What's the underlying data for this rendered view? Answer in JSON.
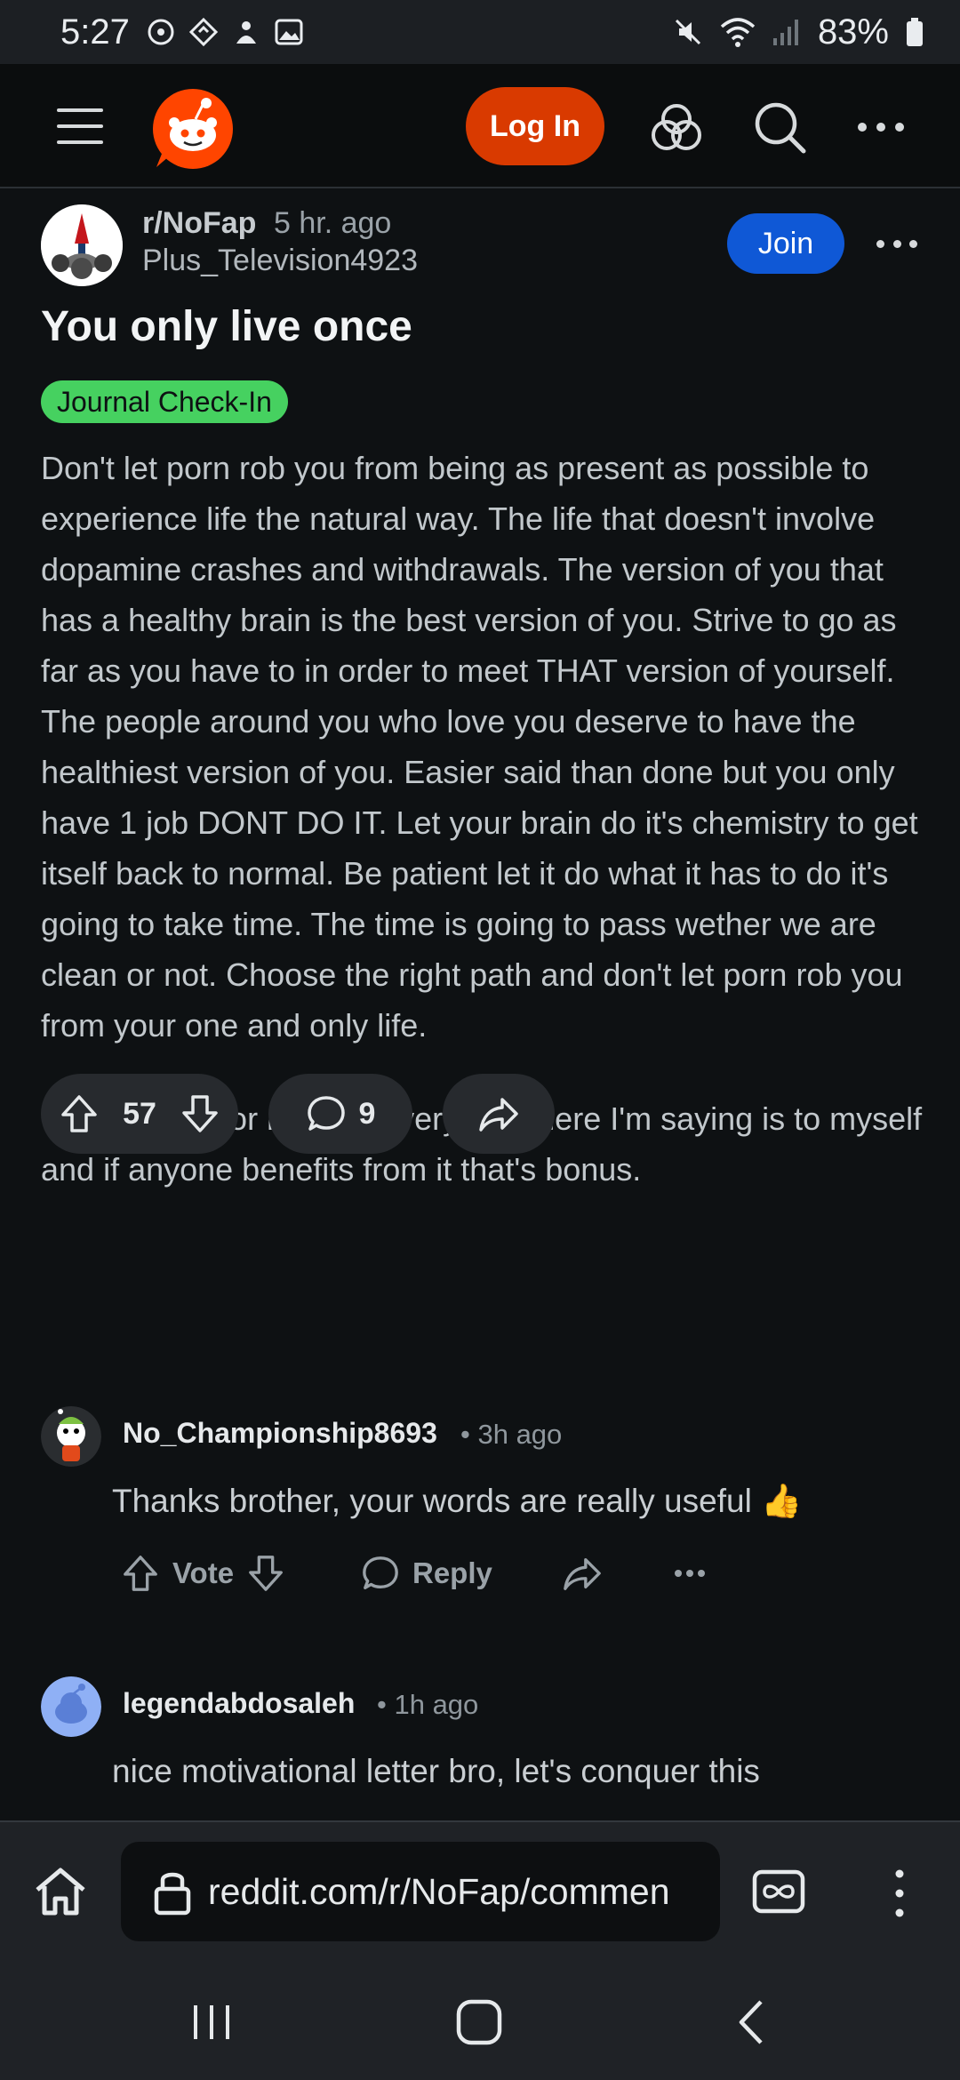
{
  "status_bar": {
    "time": "5:27",
    "battery": "83%"
  },
  "header": {
    "login_label": "Log In"
  },
  "post": {
    "subreddit": "r/NoFap",
    "time": "5 hr. ago",
    "author": "Plus_Television4923",
    "join_label": "Join",
    "title": "You only live once",
    "flair": "Journal Check-In",
    "flair_color": "#46d160",
    "paragraph1": "Don't let porn rob you from being as present as possible to experience life the natural way. The life that doesn't involve dopamine crashes and withdrawals. The version of you that has a healthy brain is the best version of you. Strive to go as far as you have to in order to meet THAT version of yourself. The people around you who love you deserve to have the healthiest version of you. Easier said than done but you only have 1 job DONT DO IT. Let your brain do it's chemistry to get itself back to normal. Be patient let it do what it has to do it's going to take time. The time is going to pass wether we are clean or not. Choose the right path and don't let porn rob you from your one and only life.",
    "paragraph2": "-Just writing for myself. Everything here I'm saying is to myself and if anyone benefits from it that's bonus.",
    "votes": "57",
    "comments": "9"
  },
  "comments": [
    {
      "author": "No_Championship8693",
      "time": "3h ago",
      "text": "Thanks brother, your words are really useful 👍",
      "vote_label": "Vote",
      "reply_label": "Reply"
    },
    {
      "author": "legendabdosaleh",
      "time": "1h ago",
      "text": "nice motivational letter bro, let's conquer this"
    }
  ],
  "browser": {
    "url": "reddit.com/r/NoFap/commen"
  },
  "colors": {
    "accent_orange": "#d93a00",
    "join_blue": "#0f58d6",
    "background": "#0e1113"
  }
}
